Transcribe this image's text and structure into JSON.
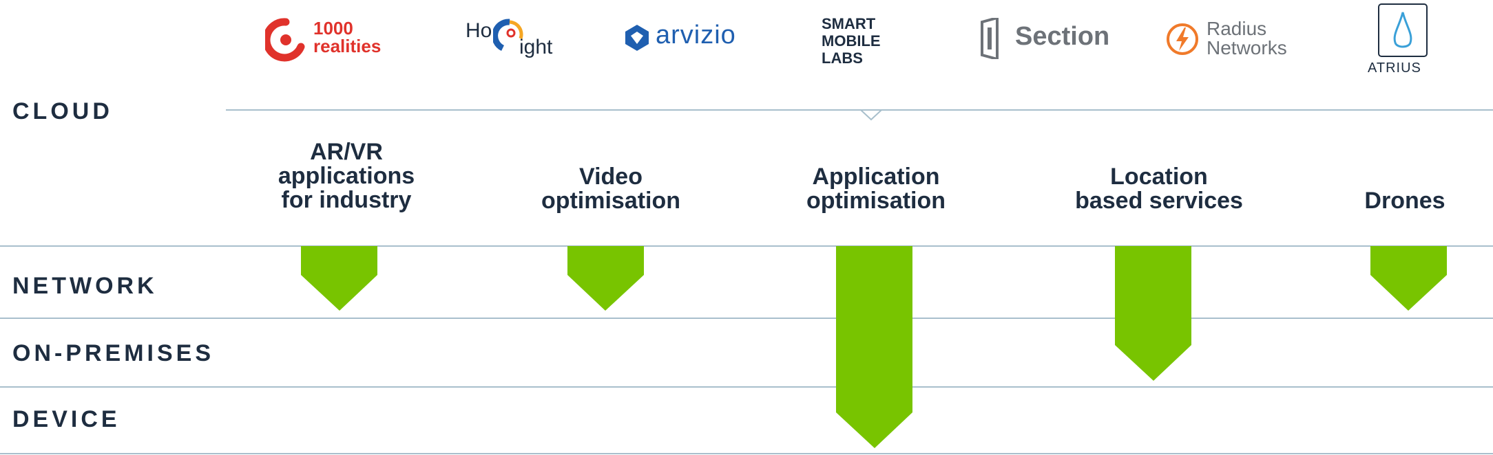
{
  "layers": {
    "cloud": "CLOUD",
    "network": "NETWORK",
    "on_premises": "ON-PREMISES",
    "device": "DEVICE"
  },
  "logos": {
    "l1000": {
      "line1": "1000",
      "line2": "realities"
    },
    "hololight": {
      "ho": "Ho",
      "ight": "ight"
    },
    "arvizio": {
      "text": "arvizio"
    },
    "sml": {
      "line1": "SMART",
      "line2": "MOBILE",
      "line3": "LABS"
    },
    "section": {
      "text": "Section"
    },
    "radius": {
      "line1": "Radius",
      "line2": "Networks"
    },
    "atrius": {
      "text": "ATRIUS"
    }
  },
  "use_cases": [
    {
      "label": "AR/VR\napplications\nfor industry",
      "reach": "NETWORK"
    },
    {
      "label": "Video\noptimisation",
      "reach": "NETWORK"
    },
    {
      "label": "Application\noptimisation",
      "reach": "DEVICE"
    },
    {
      "label": "Location\nbased services",
      "reach": "ON-PREMISES"
    },
    {
      "label": "Drones",
      "reach": "NETWORK"
    }
  ],
  "colors": {
    "accent_green": "#78c400",
    "line": "#a8bfcc",
    "text": "#1e2d40",
    "red_logo": "#e0322b",
    "blue_logo": "#1f5fb0",
    "orange_logo": "#f07a2a",
    "gray_logo": "#6d7278"
  }
}
